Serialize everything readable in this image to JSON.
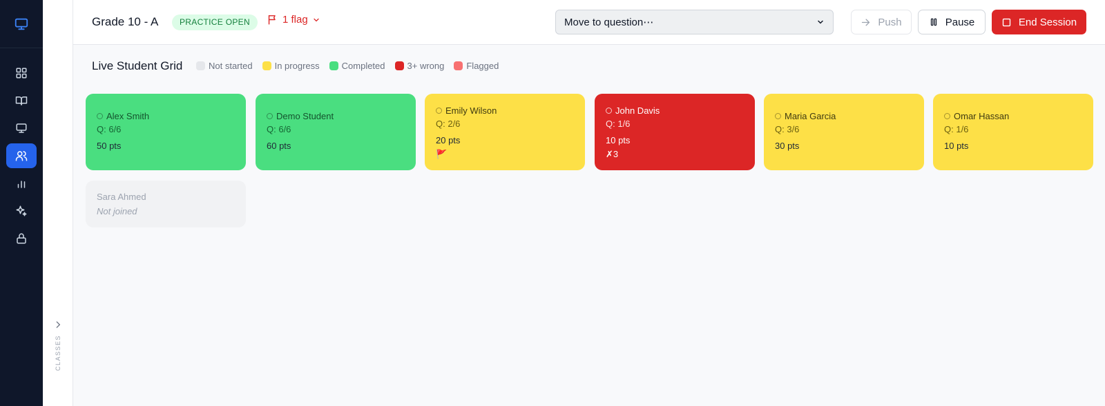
{
  "header": {
    "title": "Grade 10 - A",
    "status": "PRACTICE OPEN",
    "flags": "1 flag",
    "move_placeholder": "Move to question⋯",
    "push_label": "Push",
    "pause_label": "Pause",
    "end_label": "End Session"
  },
  "rail": {
    "label": "CLASSES"
  },
  "grid": {
    "title": "Live Student Grid",
    "legend": [
      {
        "label": "Not started",
        "color": "#e5e7eb"
      },
      {
        "label": "In progress",
        "color": "#fde047"
      },
      {
        "label": "Completed",
        "color": "#4ade80"
      },
      {
        "label": "3+ wrong",
        "color": "#dc2626"
      },
      {
        "label": "Flagged",
        "color": "#f87171"
      }
    ],
    "students": [
      {
        "name": "Alex Smith",
        "questions": "Q: 6/6",
        "points": "50 pts"
      },
      {
        "name": "Demo Student",
        "questions": "Q: 6/6",
        "points": "60 pts"
      },
      {
        "name": "Emily Wilson",
        "questions": "Q: 2/6",
        "points": "20 pts",
        "flag": "🚩"
      },
      {
        "name": "John Davis",
        "questions": "Q: 1/6",
        "points": "10 pts",
        "wrong": "✗3"
      },
      {
        "name": "Maria Garcia",
        "questions": "Q: 3/6",
        "points": "30 pts"
      },
      {
        "name": "Omar Hassan",
        "questions": "Q: 1/6",
        "points": "10 pts"
      },
      {
        "name": "Sara Ahmed",
        "status": "Not joined"
      }
    ]
  },
  "colors": {
    "accent": "#2563eb",
    "danger": "#dc2626",
    "sidebar": "#0f172a"
  }
}
